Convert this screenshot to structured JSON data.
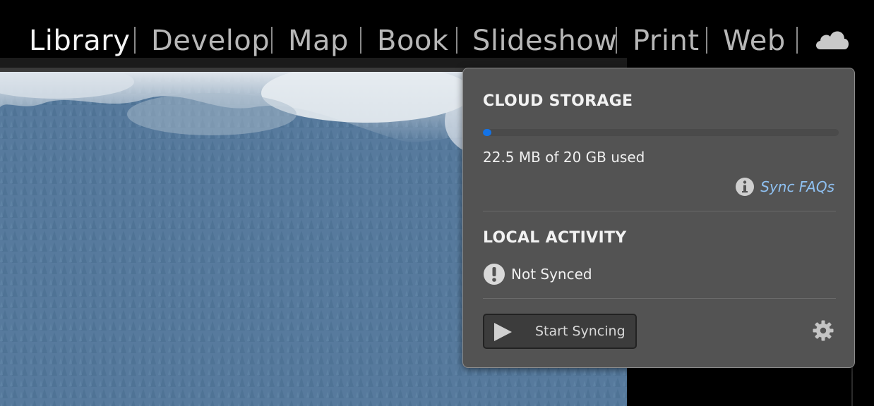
{
  "modules": [
    {
      "label": "Library",
      "active": true
    },
    {
      "label": "Develop",
      "active": false
    },
    {
      "label": "Map",
      "active": false
    },
    {
      "label": "Book",
      "active": false
    },
    {
      "label": "Slideshow",
      "active": false
    },
    {
      "label": "Print",
      "active": false
    },
    {
      "label": "Web",
      "active": false
    }
  ],
  "cloud_icon": "cloud-icon",
  "popover": {
    "cloud_storage_heading": "CLOUD STORAGE",
    "usage_fraction": 0.0011,
    "usage_text": "22.5 MB of 20 GB used",
    "faq_icon": "info-icon",
    "faq_link": "Sync FAQs",
    "local_activity_heading": "LOCAL ACTIVITY",
    "status_icon": "warning-icon",
    "status_text": "Not Synced",
    "sync_button_icon": "play-icon",
    "sync_button_label": "Start Syncing",
    "settings_icon": "gear-icon"
  },
  "colors": {
    "accent": "#1473e6",
    "link": "#8fc1f2",
    "popover_bg": "#535353"
  }
}
